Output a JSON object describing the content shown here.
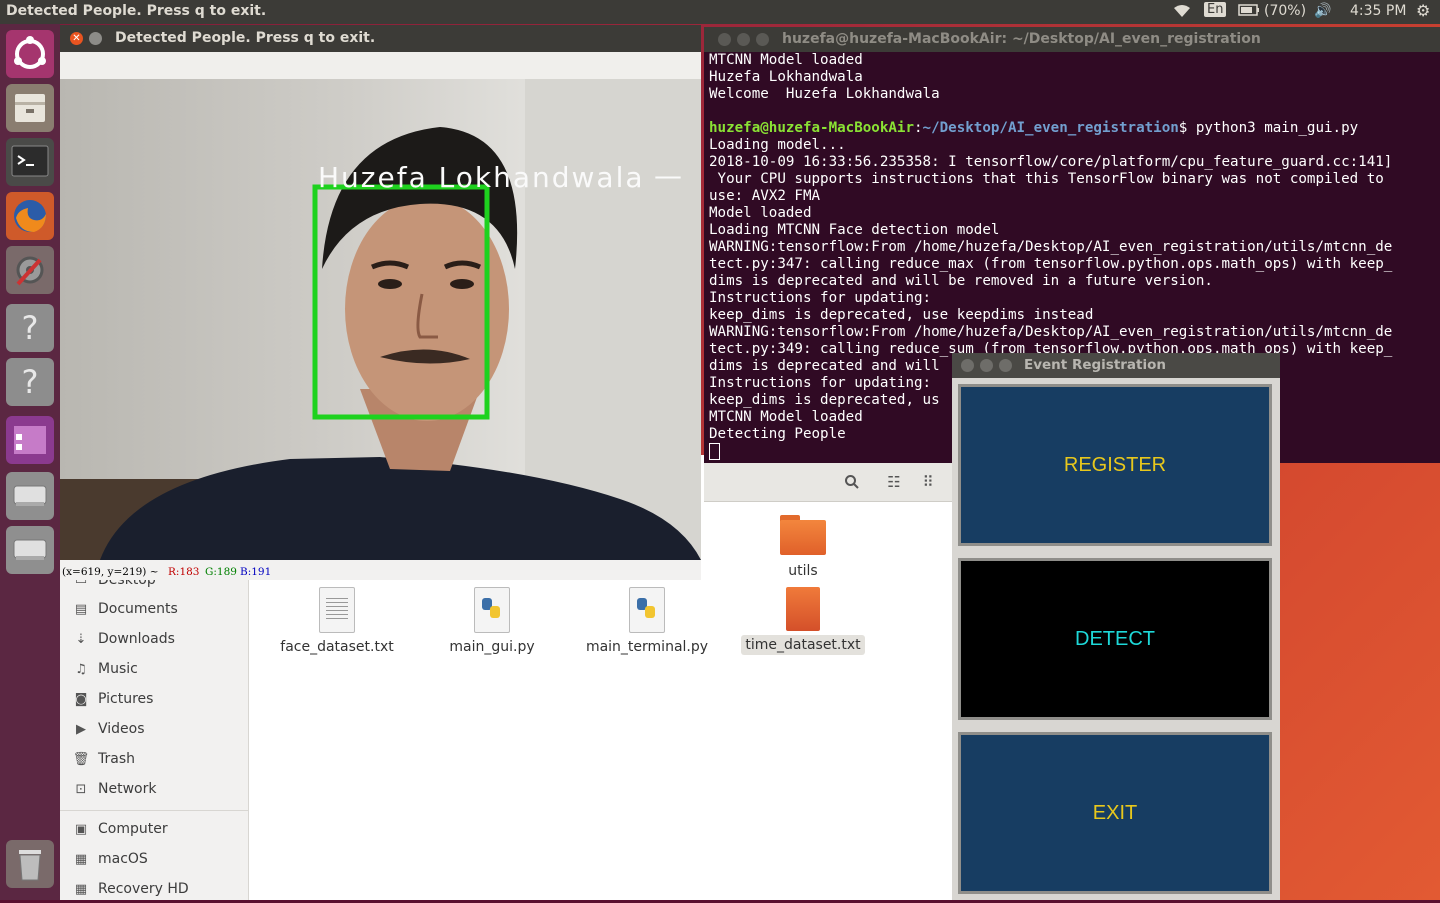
{
  "topbar": {
    "title": "Detected People. Press q to exit.",
    "keyboard": "En",
    "battery": "(70%)",
    "time": "4:35 PM"
  },
  "launcher": {
    "icons": [
      "ubuntu-icon",
      "files-icon",
      "terminal-icon",
      "firefox-icon",
      "settings-icon",
      "unknown-app-icon",
      "unknown-app-icon",
      "workspace-switcher-icon",
      "drive-icon",
      "drive-icon",
      "trash-icon"
    ]
  },
  "camera": {
    "title": "Detected People. Press q to exit.",
    "label": "Huzefa Lokhandwala",
    "status": {
      "coords": "(x=619, y=219) ~",
      "r": "R:183",
      "g": "G:189",
      "b": "B:191"
    }
  },
  "terminal": {
    "title": "huzefa@huzefa-MacBookAir: ~/Desktop/AI_even_registration",
    "lines_before": "MTCNN Model loaded\nHuzefa Lokhandwala\nWelcome  Huzefa Lokhandwala\n",
    "prompt_user": "huzefa@huzefa-MacBookAir",
    "prompt_sep": ":",
    "prompt_path": "~/Desktop/AI_even_registration",
    "prompt_cmd": "$ python3 main_gui.py",
    "lines_after": "Loading model...\n2018-10-09 16:33:56.235358: I tensorflow/core/platform/cpu_feature_guard.cc:141]\n Your CPU supports instructions that this TensorFlow binary was not compiled to\nuse: AVX2 FMA\nModel loaded\nLoading MTCNN Face detection model\nWARNING:tensorflow:From /home/huzefa/Desktop/AI_even_registration/utils/mtcnn_de\ntect.py:347: calling reduce_max (from tensorflow.python.ops.math_ops) with keep_\ndims is deprecated and will be removed in a future version.\nInstructions for updating:\nkeep_dims is deprecated, use keepdims instead\nWARNING:tensorflow:From /home/huzefa/Desktop/AI_even_registration/utils/mtcnn_de\ntect.py:349: calling reduce_sum (from tensorflow.python.ops.math_ops) with keep_\ndims is deprecated and will\nInstructions for updating:\nkeep_dims is deprecated, us\nMTCNN Model loaded\nDetecting People"
  },
  "sidebar": {
    "items": [
      {
        "label": "Desktop",
        "icon": "desktop-icon"
      },
      {
        "label": "Documents",
        "icon": "documents-icon"
      },
      {
        "label": "Downloads",
        "icon": "downloads-icon"
      },
      {
        "label": "Music",
        "icon": "music-icon"
      },
      {
        "label": "Pictures",
        "icon": "pictures-icon"
      },
      {
        "label": "Videos",
        "icon": "videos-icon"
      },
      {
        "label": "Trash",
        "icon": "trash-icon"
      },
      {
        "label": "Network",
        "icon": "network-icon"
      },
      {
        "label": "Computer",
        "icon": "computer-icon"
      },
      {
        "label": "macOS",
        "icon": "drive-icon"
      },
      {
        "label": "Recovery HD",
        "icon": "drive-icon"
      }
    ]
  },
  "files": {
    "items": [
      {
        "name": "utils",
        "type": "folder"
      },
      {
        "name": "face_dataset.txt",
        "type": "text"
      },
      {
        "name": "main_gui.py",
        "type": "python"
      },
      {
        "name": "main_terminal.py",
        "type": "python"
      },
      {
        "name": "time_dataset.txt",
        "type": "text-selected"
      }
    ]
  },
  "event_registration": {
    "title": "Event Registration",
    "buttons": {
      "register": "REGISTER",
      "detect": "DETECT",
      "exit": "EXIT"
    }
  },
  "colors": {
    "register_bg": "#173d62",
    "register_fg": "#e8c81c",
    "detect_bg": "#000000",
    "detect_fg": "#1ed8d8",
    "exit_bg": "#173d62",
    "exit_fg": "#e8c81c",
    "face_box": "#1ed21e"
  }
}
